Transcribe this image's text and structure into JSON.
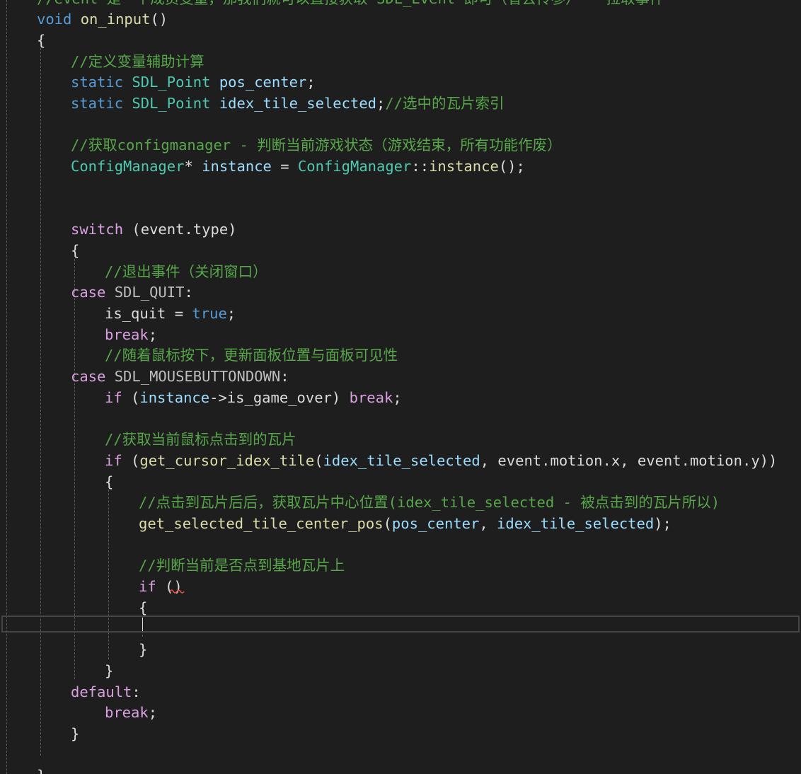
{
  "editor": {
    "colors": {
      "background": "#1e1e1e",
      "keyword": "#569cd6",
      "control_keyword": "#d8a0df",
      "type": "#4ec9b0",
      "function": "#dcdcaa",
      "variable": "#9cdcfe",
      "plain": "#dcdcdc",
      "comment": "#57a64a",
      "error_squiggle": "#f14c4c"
    },
    "lines": [
      {
        "tokens": [
          {
            "cls": "cmt",
            "text": "//event 是一个成员变量，那我们就可以直接获取 SDL_Event 即可（省去传参）-- 拉取事件"
          }
        ]
      },
      {
        "tokens": [
          {
            "cls": "kw",
            "text": "void"
          },
          {
            "cls": "plain",
            "text": " "
          },
          {
            "cls": "fn",
            "text": "on_input"
          },
          {
            "cls": "plain",
            "text": "()"
          }
        ]
      },
      {
        "tokens": [
          {
            "cls": "plain",
            "text": "{"
          }
        ]
      },
      {
        "tokens": [
          {
            "cls": "cmt",
            "text": "//定义变量辅助计算"
          }
        ]
      },
      {
        "tokens": [
          {
            "cls": "kw",
            "text": "static"
          },
          {
            "cls": "plain",
            "text": " "
          },
          {
            "cls": "typ",
            "text": "SDL_Point"
          },
          {
            "cls": "plain",
            "text": " "
          },
          {
            "cls": "var",
            "text": "pos_center"
          },
          {
            "cls": "plain",
            "text": ";"
          }
        ]
      },
      {
        "tokens": [
          {
            "cls": "kw",
            "text": "static"
          },
          {
            "cls": "plain",
            "text": " "
          },
          {
            "cls": "typ",
            "text": "SDL_Point"
          },
          {
            "cls": "plain",
            "text": " "
          },
          {
            "cls": "var",
            "text": "idex_tile_selected"
          },
          {
            "cls": "plain",
            "text": ";"
          },
          {
            "cls": "cmt",
            "text": "//选中的瓦片索引"
          }
        ]
      },
      {
        "tokens": []
      },
      {
        "tokens": [
          {
            "cls": "cmt",
            "text": "//获取configmanager - 判断当前游戏状态（游戏结束，所有功能作废）"
          }
        ]
      },
      {
        "tokens": [
          {
            "cls": "typ",
            "text": "ConfigManager"
          },
          {
            "cls": "plain",
            "text": "* "
          },
          {
            "cls": "var",
            "text": "instance"
          },
          {
            "cls": "plain",
            "text": " = "
          },
          {
            "cls": "typ",
            "text": "ConfigManager"
          },
          {
            "cls": "plain",
            "text": "::"
          },
          {
            "cls": "fn",
            "text": "instance"
          },
          {
            "cls": "plain",
            "text": "();"
          }
        ]
      },
      {
        "tokens": []
      },
      {
        "tokens": []
      },
      {
        "tokens": [
          {
            "cls": "ctl",
            "text": "switch"
          },
          {
            "cls": "plain",
            "text": " (event.type)"
          }
        ]
      },
      {
        "tokens": [
          {
            "cls": "plain",
            "text": "{"
          }
        ]
      },
      {
        "tokens": [
          {
            "cls": "cmt",
            "text": "//退出事件（关闭窗口）"
          }
        ]
      },
      {
        "tokens": [
          {
            "cls": "ctl",
            "text": "case"
          },
          {
            "cls": "plain",
            "text": " "
          },
          {
            "cls": "macro",
            "text": "SDL_QUIT"
          },
          {
            "cls": "plain",
            "text": ":"
          }
        ]
      },
      {
        "tokens": [
          {
            "cls": "plain",
            "text": "is_quit = "
          },
          {
            "cls": "kw",
            "text": "true"
          },
          {
            "cls": "plain",
            "text": ";"
          }
        ]
      },
      {
        "tokens": [
          {
            "cls": "ctl",
            "text": "break"
          },
          {
            "cls": "plain",
            "text": ";"
          }
        ]
      },
      {
        "tokens": [
          {
            "cls": "cmt",
            "text": "//随着鼠标按下，更新面板位置与面板可见性"
          }
        ]
      },
      {
        "tokens": [
          {
            "cls": "ctl",
            "text": "case"
          },
          {
            "cls": "plain",
            "text": " "
          },
          {
            "cls": "macro",
            "text": "SDL_MOUSEBUTTONDOWN"
          },
          {
            "cls": "plain",
            "text": ":"
          }
        ]
      },
      {
        "tokens": [
          {
            "cls": "ctl",
            "text": "if"
          },
          {
            "cls": "plain",
            "text": " ("
          },
          {
            "cls": "var",
            "text": "instance"
          },
          {
            "cls": "plain",
            "text": "->is_game_over) "
          },
          {
            "cls": "ctl",
            "text": "break"
          },
          {
            "cls": "plain",
            "text": ";"
          }
        ]
      },
      {
        "tokens": []
      },
      {
        "tokens": [
          {
            "cls": "cmt",
            "text": "//获取当前鼠标点击到的瓦片"
          }
        ]
      },
      {
        "tokens": [
          {
            "cls": "ctl",
            "text": "if"
          },
          {
            "cls": "plain",
            "text": " ("
          },
          {
            "cls": "fn",
            "text": "get_cursor_idex_tile"
          },
          {
            "cls": "plain",
            "text": "("
          },
          {
            "cls": "var",
            "text": "idex_tile_selected"
          },
          {
            "cls": "plain",
            "text": ", event.motion.x, event.motion.y))"
          }
        ]
      },
      {
        "tokens": [
          {
            "cls": "plain",
            "text": "{"
          }
        ]
      },
      {
        "tokens": [
          {
            "cls": "cmt",
            "text": "//点击到瓦片后后，获取瓦片中心位置(idex_tile_selected - 被点击到的瓦片所以)"
          }
        ]
      },
      {
        "tokens": [
          {
            "cls": "fn",
            "text": "get_selected_tile_center_pos"
          },
          {
            "cls": "plain",
            "text": "("
          },
          {
            "cls": "var",
            "text": "pos_center"
          },
          {
            "cls": "plain",
            "text": ", "
          },
          {
            "cls": "var",
            "text": "idex_tile_selected"
          },
          {
            "cls": "plain",
            "text": ");"
          }
        ]
      },
      {
        "tokens": []
      },
      {
        "tokens": [
          {
            "cls": "cmt",
            "text": "//判断当前是否点到基地瓦片上"
          }
        ]
      },
      {
        "tokens": [
          {
            "cls": "ctl",
            "text": "if"
          },
          {
            "cls": "plain",
            "text": " ()"
          }
        ]
      },
      {
        "tokens": [
          {
            "cls": "plain",
            "text": "{"
          }
        ]
      },
      {
        "tokens": []
      },
      {
        "tokens": [
          {
            "cls": "plain",
            "text": "}"
          }
        ]
      },
      {
        "tokens": [
          {
            "cls": "plain",
            "text": "}"
          }
        ]
      },
      {
        "tokens": [
          {
            "cls": "ctl",
            "text": "default"
          },
          {
            "cls": "plain",
            "text": ":"
          }
        ]
      },
      {
        "tokens": [
          {
            "cls": "ctl",
            "text": "break"
          },
          {
            "cls": "plain",
            "text": ";"
          }
        ]
      },
      {
        "tokens": [
          {
            "cls": "plain",
            "text": "}"
          }
        ]
      },
      {
        "tokens": []
      },
      {
        "tokens": [
          {
            "cls": "plain",
            "text": "}"
          }
        ]
      }
    ]
  }
}
